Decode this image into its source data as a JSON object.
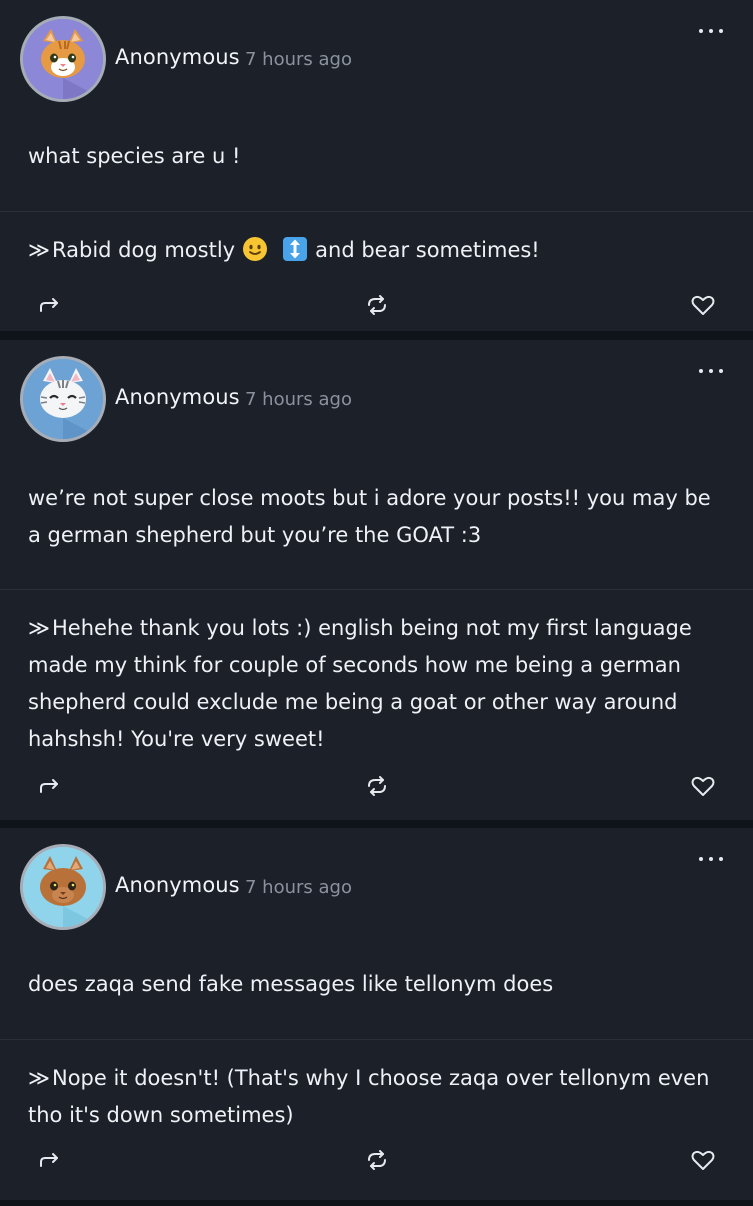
{
  "colors": {
    "background": "#0f131a",
    "card": "#1b2029",
    "text": "#eef1f5",
    "muted": "#8b929d",
    "avatar_purple": "#8c87d6",
    "avatar_blue": "#6da2d4",
    "avatar_cyan": "#8fd4ea"
  },
  "posts": [
    {
      "avatar_icon": "orange-cat-avatar-icon",
      "username": "Anonymous",
      "timestamp": "7 hours ago",
      "question": "what species are u !",
      "answer_prefix": "≫",
      "answer_text_1": "Rabid dog mostly",
      "answer_emoji_1": "slightly-smiling-face-emoji",
      "answer_emoji_2": "up-down-arrow-emoji",
      "answer_text_2": "and bear sometimes!"
    },
    {
      "avatar_icon": "white-cat-avatar-icon",
      "username": "Anonymous",
      "timestamp": "7 hours ago",
      "question": "we’re not super close moots but i adore your posts!! you may be a german shepherd but you’re the GOAT :3",
      "answer_prefix": "≫",
      "answer_text": "Hehehe thank you lots :) english being not my first language made my think for couple of seconds how me being a german shepherd could exclude me being a goat or other way around hahshsh! You're very sweet!"
    },
    {
      "avatar_icon": "brown-cat-avatar-icon",
      "username": "Anonymous",
      "timestamp": "7 hours ago",
      "question": "does zaqa send fake messages like tellonym does",
      "answer_prefix": "≫",
      "answer_text": "Nope it doesn't! (That's why I choose zaqa over tellonym even tho it's down sometimes)"
    }
  ]
}
